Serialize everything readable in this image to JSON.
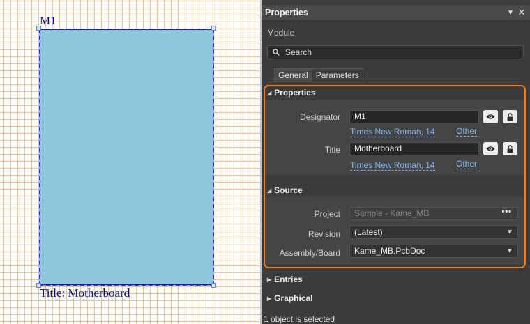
{
  "canvas": {
    "designator": "M1",
    "title": "Title: Motherboard"
  },
  "panel": {
    "title": "Properties",
    "header_pin_icon": "dropdown-triangle",
    "close_icon": "close-x",
    "object_kind": "Module",
    "search": {
      "placeholder": "Search"
    },
    "tabs": [
      {
        "label": "General",
        "active": true
      },
      {
        "label": "Parameters",
        "active": false
      }
    ],
    "properties_section": {
      "heading": "Properties",
      "designator": {
        "label": "Designator",
        "value": "M1",
        "font": "Times New Roman, 14",
        "other": "Other"
      },
      "title": {
        "label": "Title",
        "value": "Motherboard",
        "font": "Times New Roman, 14",
        "other": "Other"
      }
    },
    "source_section": {
      "heading": "Source",
      "project": {
        "label": "Project",
        "value": "Sample - Kame_MB",
        "more": "•••"
      },
      "revision": {
        "label": "Revision",
        "value": "(Latest)"
      },
      "assembly": {
        "label": "Assembly/Board",
        "value": "Kame_MB.PcbDoc"
      }
    },
    "collapsed_sections": [
      "Entries",
      "Graphical"
    ],
    "status": "1 object is selected"
  },
  "colors": {
    "highlight": "#f07c1c",
    "module_fill": "#8fc9dc",
    "link": "#85b5ea",
    "panel_bg": "#3b3b3b"
  }
}
